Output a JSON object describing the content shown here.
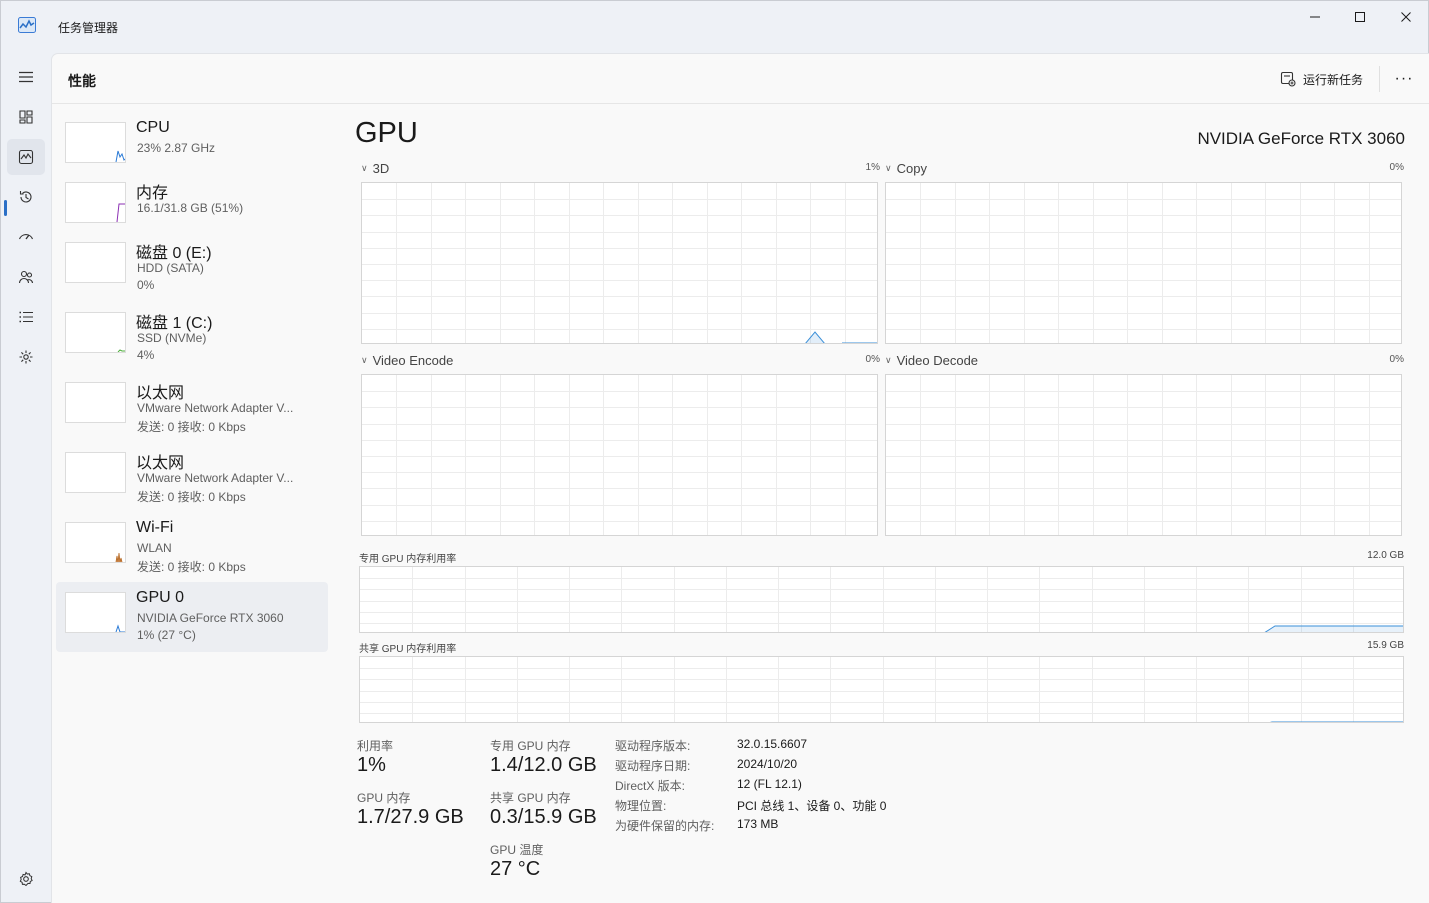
{
  "app": {
    "title": "任务管理器"
  },
  "page": {
    "title": "性能",
    "run_task": "运行新任务",
    "more": "···"
  },
  "rail": {
    "items": [
      {
        "name": "hamburger-icon"
      },
      {
        "name": "processes-icon"
      },
      {
        "name": "performance-icon"
      },
      {
        "name": "app-history-icon"
      },
      {
        "name": "startup-icon"
      },
      {
        "name": "users-icon"
      },
      {
        "name": "details-icon"
      },
      {
        "name": "services-icon"
      },
      {
        "name": "settings-icon"
      }
    ]
  },
  "devices": [
    {
      "name": "CPU",
      "line1": "23% 2.87 GHz",
      "line2": ""
    },
    {
      "name": "内存",
      "line1": "16.1/31.8 GB (51%)",
      "line2": ""
    },
    {
      "name": "磁盘 0 (E:)",
      "line1": "HDD (SATA)",
      "line2": "0%"
    },
    {
      "name": "磁盘 1 (C:)",
      "line1": "SSD (NVMe)",
      "line2": "4%"
    },
    {
      "name": "以太网",
      "line1": "VMware Network Adapter V...",
      "line2": "发送: 0 接收: 0 Kbps"
    },
    {
      "name": "以太网",
      "line1": "VMware Network Adapter V...",
      "line2": "发送: 0 接收: 0 Kbps"
    },
    {
      "name": "Wi-Fi",
      "line1": "WLAN",
      "line2": "发送: 0 接收: 0 Kbps"
    },
    {
      "name": "GPU 0",
      "line1": "NVIDIA GeForce RTX 3060",
      "line2": "1% (27 °C)"
    }
  ],
  "gpu": {
    "title": "GPU",
    "model": "NVIDIA GeForce RTX 3060",
    "engines": [
      {
        "label": "3D",
        "pct": "1%"
      },
      {
        "label": "Copy",
        "pct": "0%"
      },
      {
        "label": "Video Encode",
        "pct": "0%"
      },
      {
        "label": "Video Decode",
        "pct": "0%"
      }
    ],
    "dedicated_mem": {
      "label": "专用 GPU 内存利用率",
      "max": "12.0 GB"
    },
    "shared_mem": {
      "label": "共享 GPU 内存利用率",
      "max": "15.9 GB"
    },
    "stats": {
      "utilization": {
        "label": "利用率",
        "value": "1%"
      },
      "gpu_mem": {
        "label": "GPU 内存",
        "value": "1.7/27.9 GB"
      },
      "dedicated": {
        "label": "专用 GPU 内存",
        "value": "1.4/12.0 GB"
      },
      "shared": {
        "label": "共享 GPU 内存",
        "value": "0.3/15.9 GB"
      },
      "temp": {
        "label": "GPU 温度",
        "value": "27 °C"
      }
    },
    "info": [
      {
        "key": "驱动程序版本:",
        "val": "32.0.15.6607"
      },
      {
        "key": "驱动程序日期:",
        "val": "2024/10/20"
      },
      {
        "key": "DirectX 版本:",
        "val": "12 (FL 12.1)"
      },
      {
        "key": "物理位置:",
        "val": "PCI 总线 1、设备 0、功能 0"
      },
      {
        "key": "为硬件保留的内存:",
        "val": "173 MB"
      }
    ]
  },
  "colors": {
    "accent": "#2a6fc6",
    "gpu_line": "#3a8fd8",
    "mem_line": "#8b2fb3",
    "disk_line": "#4cae3b",
    "net_line": "#b5651d"
  }
}
